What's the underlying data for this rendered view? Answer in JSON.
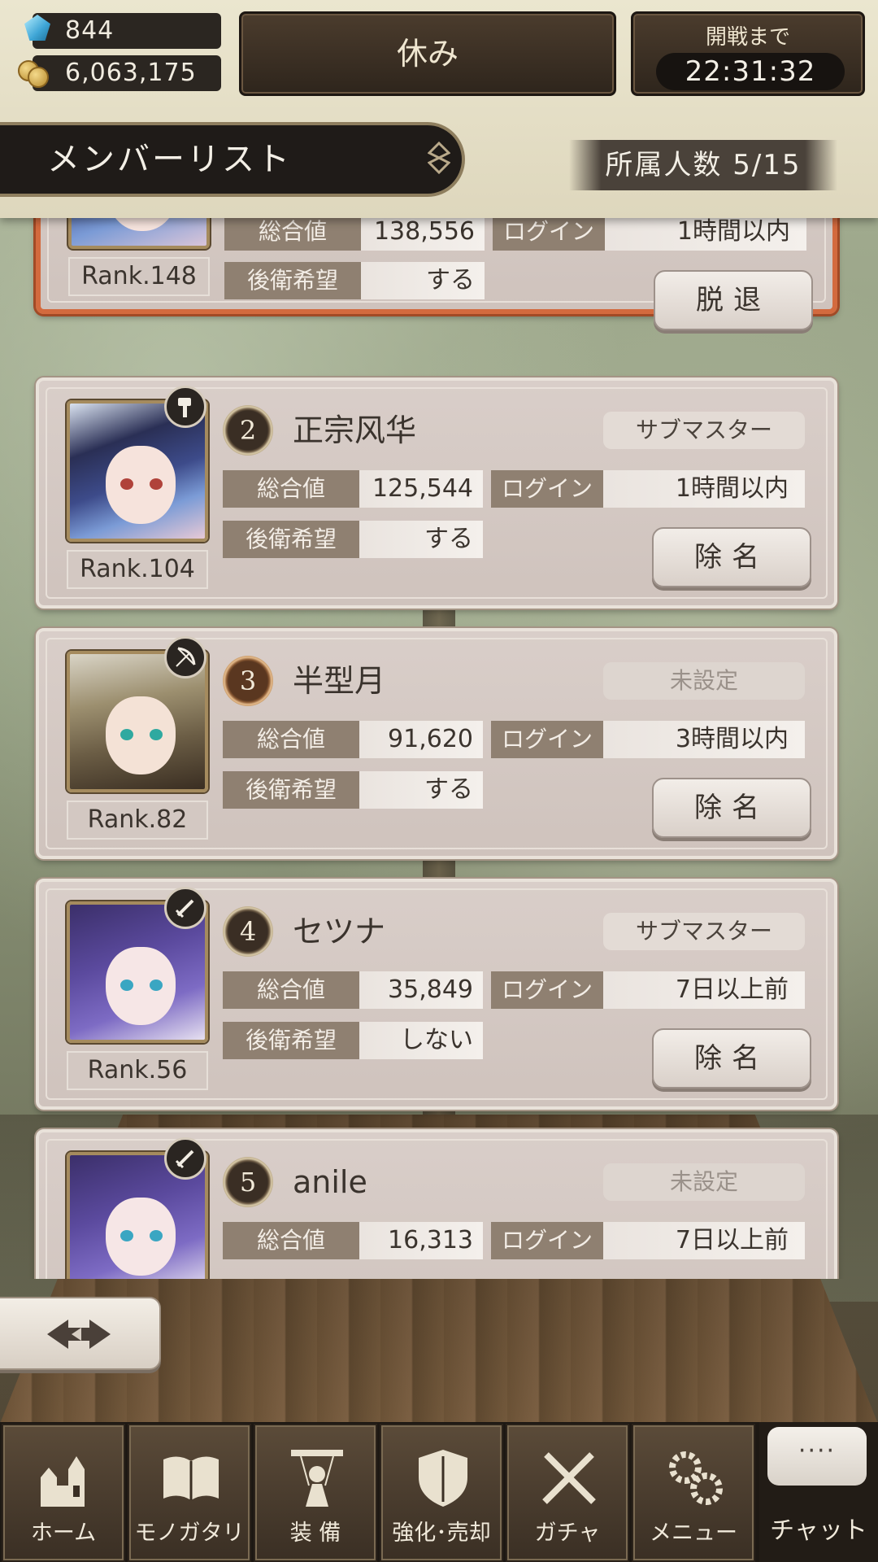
{
  "header": {
    "gems": "844",
    "coins": "6,063,175",
    "status_label": "休み",
    "timer_label": "開戦まで",
    "timer_value": "22:31:32",
    "list_title": "メンバーリスト",
    "member_count": "所属人数 5/15"
  },
  "labels": {
    "total": "総合値",
    "login": "ログイン",
    "rear_guard": "後衛希望"
  },
  "members": [
    {
      "rank": "Rank.148",
      "total": "138,556",
      "login": "1時間以内",
      "rear": "する",
      "action": "脱退"
    },
    {
      "num": "2",
      "name": "正宗风华",
      "role": "サブマスター",
      "rank": "Rank.104",
      "total": "125,544",
      "login": "1時間以内",
      "rear": "する",
      "action": "除名",
      "role_icon": "hammer-icon"
    },
    {
      "num": "3",
      "name": "半型月",
      "role": "未設定",
      "rank": "Rank.82",
      "total": "91,620",
      "login": "3時間以内",
      "rear": "する",
      "action": "除名",
      "role_icon": "bow-icon"
    },
    {
      "num": "4",
      "name": "セツナ",
      "role": "サブマスター",
      "rank": "Rank.56",
      "total": "35,849",
      "login": "7日以上前",
      "rear": "しない",
      "action": "除名",
      "role_icon": "sword-icon"
    },
    {
      "num": "5",
      "name": "anile",
      "role": "未設定",
      "total": "16,313",
      "login": "7日以上前",
      "role_icon": "sword-icon"
    }
  ],
  "nav": {
    "home": "ホーム",
    "story": "モノガタリ",
    "equip": "装 備",
    "enhance": "強化･売却",
    "gacha": "ガチャ",
    "menu": "メニュー",
    "chat": "チャット",
    "chat_bubble": "····"
  },
  "colors": {
    "self_border": "#d36a3e",
    "stat_label_bg": "#8f8071",
    "header_bg": "#ebe6cf"
  }
}
